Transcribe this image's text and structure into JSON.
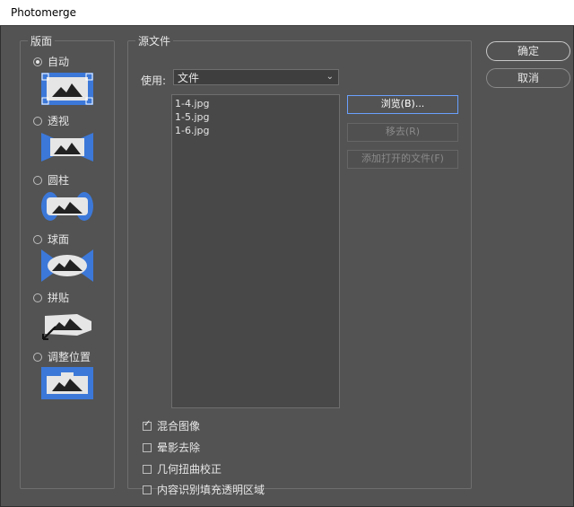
{
  "window": {
    "title": "Photomerge"
  },
  "layout": {
    "legend": "版面",
    "options": [
      {
        "label": "自动",
        "checked": true,
        "icon": "auto-layout-icon"
      },
      {
        "label": "透视",
        "checked": false,
        "icon": "perspective-layout-icon"
      },
      {
        "label": "圆柱",
        "checked": false,
        "icon": "cylindrical-layout-icon"
      },
      {
        "label": "球面",
        "checked": false,
        "icon": "spherical-layout-icon"
      },
      {
        "label": "拼贴",
        "checked": false,
        "icon": "collage-layout-icon"
      },
      {
        "label": "调整位置",
        "checked": false,
        "icon": "reposition-layout-icon"
      }
    ]
  },
  "source": {
    "legend": "源文件",
    "use_label": "使用:",
    "use_value": "文件",
    "files": [
      "1-4.jpg",
      "1-5.jpg",
      "1-6.jpg"
    ],
    "browse_label": "浏览(B)...",
    "remove_label": "移去(R)",
    "add_open_label": "添加打开的文件(F)"
  },
  "options": [
    {
      "label": "混合图像",
      "checked": true
    },
    {
      "label": "晕影去除",
      "checked": false
    },
    {
      "label": "几何扭曲校正",
      "checked": false
    },
    {
      "label": "内容识别填充透明区域",
      "checked": false
    }
  ],
  "buttons": {
    "ok": "确定",
    "cancel": "取消"
  },
  "colors": {
    "accent": "#3c78d8",
    "panel": "#535353",
    "thumb": "#e6e6e6"
  }
}
